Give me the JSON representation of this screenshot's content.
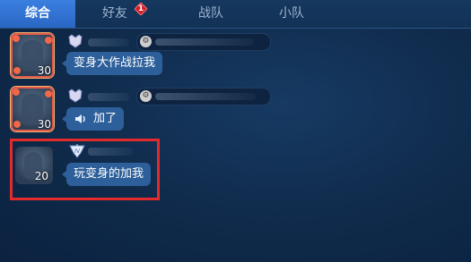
{
  "tabs": [
    {
      "label": "综合",
      "active": true
    },
    {
      "label": "好友",
      "active": false,
      "badge": "1"
    },
    {
      "label": "战队",
      "active": false
    },
    {
      "label": "小队",
      "active": false
    }
  ],
  "messages": [
    {
      "level": "30",
      "text": "变身大作战拉我",
      "voice": false
    },
    {
      "level": "30",
      "text": "加了",
      "voice": true
    },
    {
      "level": "20",
      "text": "玩变身的加我",
      "voice": false,
      "highlighted": true
    }
  ],
  "colors": {
    "tab_active": "#2f6fd1",
    "bubble": "#2d5f9a",
    "highlight_border": "#e32b2b",
    "badge": "#d01e2a"
  }
}
